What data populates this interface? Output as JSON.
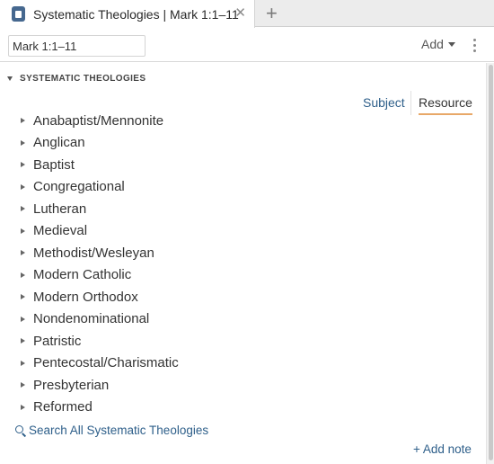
{
  "tab": {
    "title": "Systematic Theologies | Mark 1:1–11",
    "close_glyph": "✕",
    "new_tab_glyph": "+"
  },
  "toolbar": {
    "reference_value": "Mark 1:1–11",
    "add_label": "Add"
  },
  "section": {
    "title": "SYSTEMATIC THEOLOGIES"
  },
  "view_toggle": {
    "subject_label": "Subject",
    "resource_label": "Resource",
    "selected": "Resource"
  },
  "tree": {
    "items": [
      "Anabaptist/Mennonite",
      "Anglican",
      "Baptist",
      "Congregational",
      "Lutheran",
      "Medieval",
      "Methodist/Wesleyan",
      "Modern Catholic",
      "Modern Orthodox",
      "Nondenominational",
      "Patristic",
      "Pentecostal/Charismatic",
      "Presbyterian",
      "Reformed"
    ]
  },
  "footer": {
    "search_all_label": "Search All Systematic Theologies",
    "add_note_label": "+ Add note"
  },
  "colors": {
    "link_blue": "#2e5f8a",
    "tab_icon": "#46688f",
    "selected_underline": "#e8a868"
  },
  "icons": {
    "tab": "book-icon",
    "search": "search-icon",
    "menu": "kebab-menu-icon"
  }
}
